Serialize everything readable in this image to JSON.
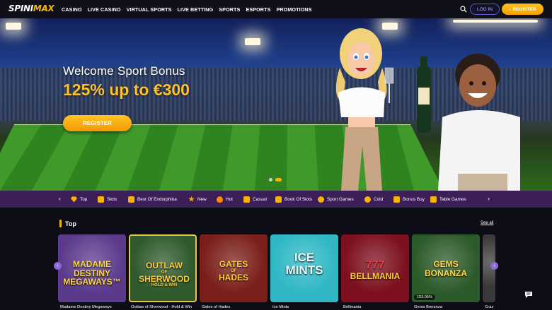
{
  "header": {
    "logo_part1": "SPINI",
    "logo_part2": "MAX",
    "nav": [
      "CASINO",
      "LIVE CASINO",
      "VIRTUAL SPORTS",
      "LIVE BETTING",
      "SPORTS",
      "ESPORTS",
      "PROMOTIONS"
    ],
    "login_label": "LOG IN",
    "register_label": "REGISTER",
    "register_arrow": "›"
  },
  "hero": {
    "title": "Welcome Sport Bonus",
    "bonus": "125% up to €300",
    "cta_label": "REGISTER"
  },
  "categories": {
    "prev_arrow": "‹",
    "next_arrow": "›",
    "items": [
      {
        "label": "Top",
        "icon": "diamond-icon"
      },
      {
        "label": "Slots",
        "icon": "slot-machine-icon"
      },
      {
        "label": "Best Of Endorphina",
        "icon": "calendar-icon"
      },
      {
        "label": "New",
        "icon": "star-icon"
      },
      {
        "label": "Hot",
        "icon": "flame-icon"
      },
      {
        "label": "Casual",
        "icon": "casual-icon"
      },
      {
        "label": "Book Of Slots",
        "icon": "book-icon"
      },
      {
        "label": "Sport Games",
        "icon": "ball-icon"
      },
      {
        "label": "Cold",
        "icon": "snowflake-icon"
      },
      {
        "label": "Bonus Buy",
        "icon": "cart-icon"
      },
      {
        "label": "Table Games",
        "icon": "table-icon"
      }
    ]
  },
  "top_section": {
    "title": "Top",
    "see_all": "See all",
    "games": [
      {
        "name": "Madame Destiny Megaways",
        "art": [
          "MADAME",
          "DESTINY",
          "MEGAWAYS™"
        ],
        "bg": "#5b3a8c"
      },
      {
        "name": "Outlaw of Sherwood - Hold & Win",
        "art": [
          "OUTLAW",
          "OF",
          "SHERWOOD",
          "HOLD & WIN"
        ],
        "bg": "#2f5a2c"
      },
      {
        "name": "Gates of Hades",
        "art": [
          "GATES",
          "OF",
          "HADES"
        ],
        "bg": "#7a1f1a"
      },
      {
        "name": "Ice Mints",
        "art": [
          "ICE",
          "MINTS"
        ],
        "bg": "#2fb8c4"
      },
      {
        "name": "Bellmania",
        "art": [
          "777",
          "BELLMANIA"
        ],
        "bg": "#7d0f1e"
      },
      {
        "name": "Gems Bonanza",
        "art": [
          "GEMS",
          "BONANZA"
        ],
        "bg": "#2d5a2a",
        "rtp": "153.06%"
      },
      {
        "name": "Craz",
        "art": [],
        "bg": "#3a3a3a"
      }
    ]
  },
  "colors": {
    "accent": "#f6b400",
    "category_bar": "#3c1f58",
    "login_border": "#5a59c9"
  }
}
